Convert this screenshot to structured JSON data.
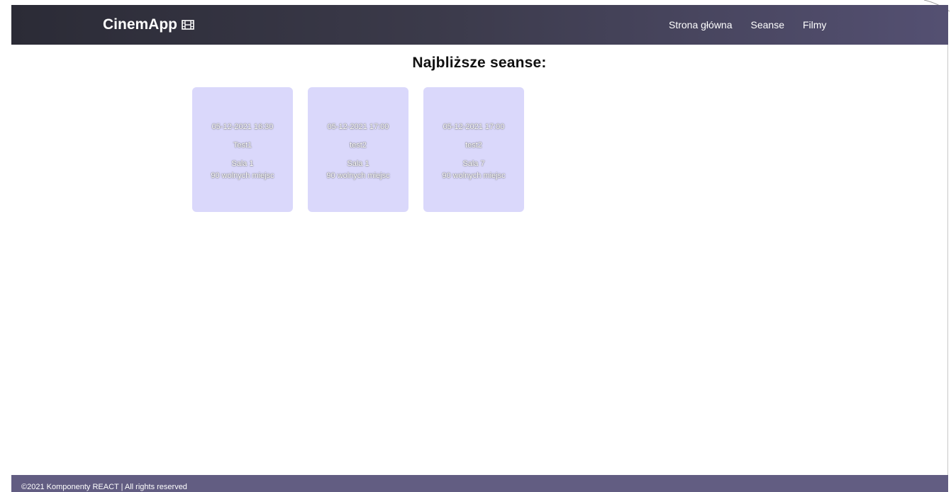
{
  "navbar": {
    "brand": "CinemApp",
    "brand_icon": "film-icon",
    "links": [
      {
        "label": "Strona główna"
      },
      {
        "label": "Seanse"
      },
      {
        "label": "Filmy"
      }
    ]
  },
  "main": {
    "heading": "Najbliższe seanse:",
    "screenings": [
      {
        "datetime": "05-12-2021 16:30",
        "title": "Test1",
        "room": "Sala 1",
        "free_seats": "90 wolnych miejsc"
      },
      {
        "datetime": "05-12-2021 17:00",
        "title": "test2",
        "room": "Sala 1",
        "free_seats": "90 wolnych miejsc"
      },
      {
        "datetime": "05-12-2021 17:00",
        "title": "test2",
        "room": "Sala 7",
        "free_seats": "90 wolnych miejsc"
      }
    ]
  },
  "footer": {
    "text": "©2021 Komponenty REACT | All rights reserved"
  },
  "colors": {
    "navbar_start": "#2b2b36",
    "navbar_end": "#545072",
    "card_bg": "#dad8fb",
    "footer_bg": "#625d82"
  }
}
